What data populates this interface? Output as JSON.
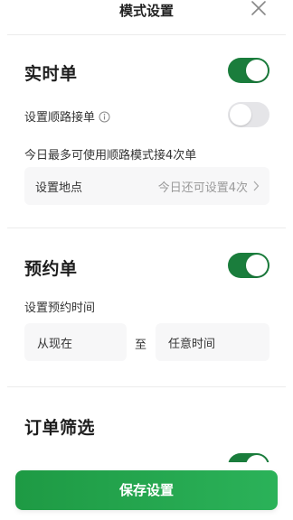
{
  "header": {
    "title": "模式设置"
  },
  "realtime": {
    "title": "实时单",
    "toggle_on": true,
    "shunlu_label": "设置顺路接单",
    "shunlu_on": false,
    "limit_text": "今日最多可使用顺路模式接4次单",
    "location_label": "设置地点",
    "location_hint": "今日还可设置4次"
  },
  "reservation": {
    "title": "预约单",
    "toggle_on": true,
    "time_label": "设置预约时间",
    "from": "从现在",
    "to_word": "至",
    "to": "任意时间"
  },
  "filter": {
    "title": "订单筛选",
    "toggle_on": true
  },
  "footer": {
    "save_label": "保存设置"
  },
  "colors": {
    "accent": "#1a7d3c",
    "button": "#22a54d"
  }
}
